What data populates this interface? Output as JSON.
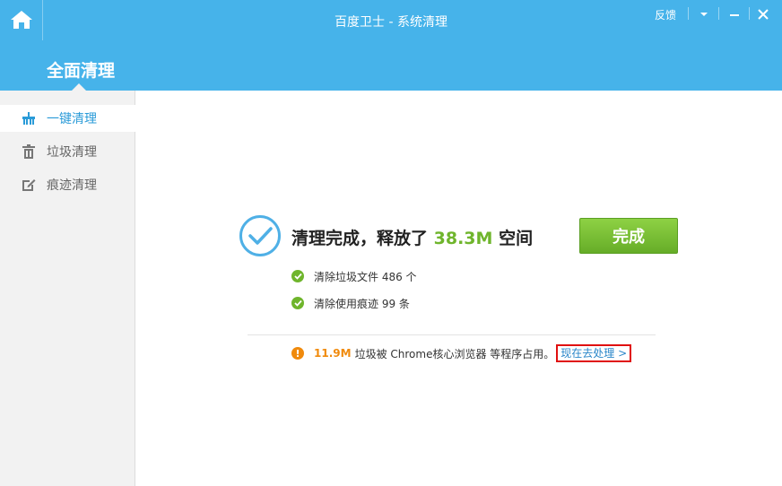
{
  "window": {
    "title": "百度卫士 - 系统清理",
    "feedback_label": "反馈"
  },
  "header": {
    "tab_label": "全面清理"
  },
  "sidebar": {
    "items": [
      {
        "label": "一键清理",
        "icon": "broom-icon",
        "active": true
      },
      {
        "label": "垃圾清理",
        "icon": "trash-icon",
        "active": false
      },
      {
        "label": "痕迹清理",
        "icon": "edit-icon",
        "active": false
      }
    ]
  },
  "result": {
    "title_prefix": "清理完成，释放了",
    "freed_size": "38.3M",
    "title_suffix": "空间",
    "done_label": "完成",
    "details": [
      "清除垃圾文件 486 个",
      "清除使用痕迹 99 条"
    ]
  },
  "warning": {
    "size": "11.9M",
    "text": "垃圾被 Chrome核心浏览器 等程序占用。",
    "link_label": "现在去处理 >"
  },
  "colors": {
    "header_bg": "#46b3ea",
    "accent_green": "#6fb52c",
    "warning_orange": "#f08a0c",
    "link_blue": "#2a86c9",
    "highlight_red": "#e01010"
  }
}
